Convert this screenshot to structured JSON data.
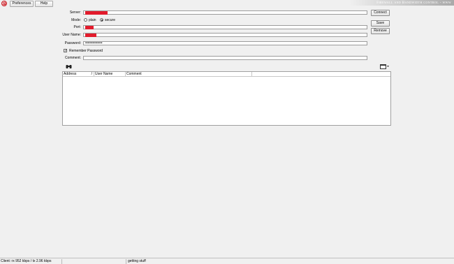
{
  "menu": {
    "preferences": "Preferences",
    "help": "Help"
  },
  "brand": "Firewall and Bandwidth control - www",
  "form": {
    "server_label": "Server:",
    "server_value": "",
    "mode_label": "Mode:",
    "mode_plain": "plain",
    "mode_secure": "secure",
    "mode_selected": "secure",
    "port_label": "Port:",
    "port_value": "",
    "username_label": "User Name:",
    "username_value": "",
    "password_label": "Password:",
    "password_value": "••••••••••••••",
    "remember_label": "Remember Password",
    "remember_checked": true,
    "comment_label": "Comment:",
    "comment_value": ""
  },
  "buttons": {
    "connect": "Connect",
    "save": "Save",
    "remove": "Remove"
  },
  "table": {
    "columns": [
      "Address",
      "User Name",
      "Comment"
    ],
    "rows": []
  },
  "status": {
    "client": "Client: rx 952 kbps / tx 2.96 kbps",
    "message": "getting stuff"
  },
  "colors": {
    "redaction": "#e21b2c",
    "logo": "#c8141c"
  },
  "icons": {
    "logo": "logo-icon",
    "find": "binoculars-icon",
    "columns": "column-chooser-icon"
  }
}
